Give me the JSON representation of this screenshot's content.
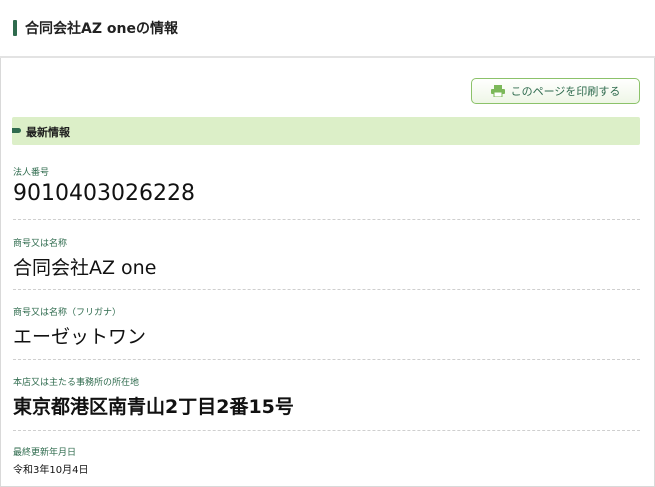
{
  "header": {
    "title": "合同会社AZ oneの情報"
  },
  "print_button": {
    "label": "このページを印刷する",
    "icon": "printer-icon"
  },
  "section": {
    "title": "最新情報"
  },
  "fields": [
    {
      "label": "法人番号",
      "value": "9010403026228"
    },
    {
      "label": "商号又は名称",
      "value": "合同会社AZ one"
    },
    {
      "label": "商号又は名称（フリガナ）",
      "value": "エーゼットワン"
    },
    {
      "label": "本店又は主たる事務所の所在地",
      "value": "東京都港区南青山2丁目2番15号"
    },
    {
      "label": "最終更新年月日",
      "value": "令和3年10月4日"
    }
  ],
  "colors": {
    "accent": "#2f6b4e",
    "section_bg": "#dcefc8",
    "button_border": "#8cc26a"
  }
}
